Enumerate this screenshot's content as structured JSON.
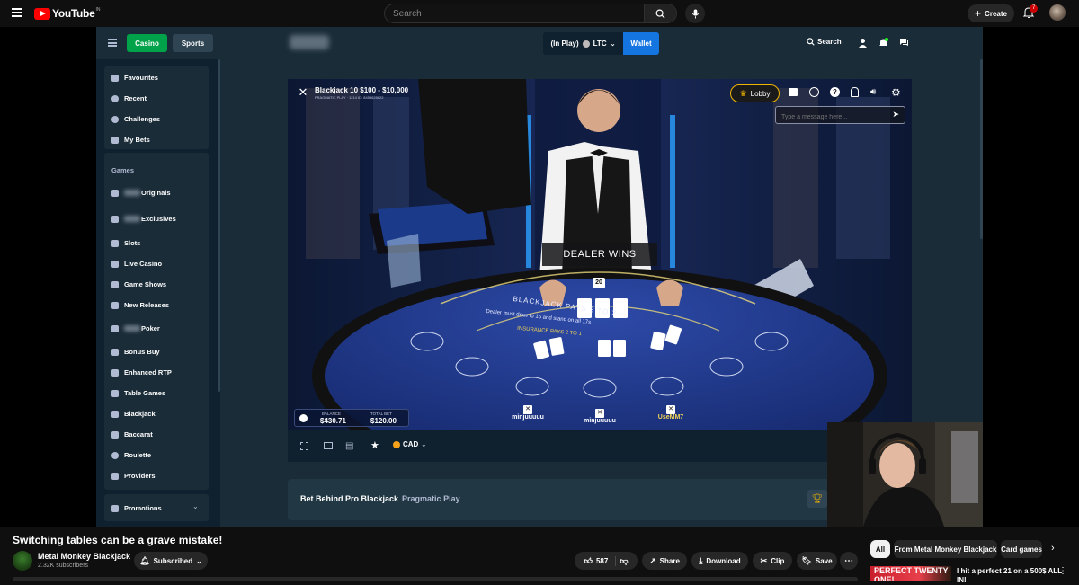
{
  "youtube": {
    "logo_text": "YouTube",
    "country_code": "IN",
    "search_placeholder": "Search",
    "create_label": "Create",
    "notification_count": "7"
  },
  "stake": {
    "tabs": {
      "casino": "Casino",
      "sports": "Sports"
    },
    "balance_label": "(In Play)",
    "currency": "LTC",
    "wallet_label": "Wallet",
    "search_label": "Search",
    "sidebar": {
      "top": [
        "Favourites",
        "Recent",
        "Challenges",
        "My Bets"
      ],
      "games_heading": "Games",
      "games": [
        {
          "label": "Originals",
          "icon": "flame-icon"
        },
        {
          "label": "Exclusives",
          "icon": "bookmark-icon"
        },
        {
          "label": "Slots",
          "icon": "slots-icon"
        },
        {
          "label": "Live Casino",
          "icon": "headset-icon"
        },
        {
          "label": "Game Shows",
          "icon": "gameshow-icon"
        },
        {
          "label": "New Releases",
          "icon": "new-icon"
        },
        {
          "label": "Poker",
          "icon": "poker-icon"
        },
        {
          "label": "Bonus Buy",
          "icon": "bonus-icon"
        },
        {
          "label": "Enhanced RTP",
          "icon": "rtp-icon"
        },
        {
          "label": "Table Games",
          "icon": "table-icon"
        },
        {
          "label": "Blackjack",
          "icon": "blackjack-icon"
        },
        {
          "label": "Baccarat",
          "icon": "baccarat-icon"
        },
        {
          "label": "Roulette",
          "icon": "roulette-icon"
        },
        {
          "label": "Providers",
          "icon": "providers-icon"
        }
      ],
      "promotions": "Promotions"
    },
    "game": {
      "table_title": "Blackjack 10 $100 - $10,000",
      "table_sub": "PRAGMATIC PLAY · 1214 ID: 8458625622",
      "lobby_label": "Lobby",
      "chat_placeholder": "Type a message here...",
      "result_banner": "DEALER WINS",
      "dealer_score": "20",
      "felt_line1": "BLACKJACK PAYS 3 TO 2",
      "felt_line2": "Dealer must draw to 16 and stand on all 17s",
      "felt_line3": "INSURANCE PAYS 2 TO 1",
      "balance_label": "BALANCE",
      "balance_value": "$430.71",
      "total_bet_label": "TOTAL BET",
      "total_bet_value": "$120.00",
      "bet_behind": "BET BEHIND",
      "players": [
        "minjuuuuu",
        "minjuuuuu",
        "UseMM7"
      ],
      "currency_label": "CAD"
    },
    "info": {
      "title": "Bet Behind Pro Blackjack",
      "provider": "Pragmatic Play"
    }
  },
  "video": {
    "title": "Switching tables can be a grave mistake!",
    "channel": "Metal Monkey Blackjack",
    "subscribers": "2.32K subscribers",
    "subscribed_label": "Subscribed",
    "likes": "587",
    "share_label": "Share",
    "download_label": "Download",
    "clip_label": "Clip",
    "save_label": "Save"
  },
  "chips": [
    "All",
    "From Metal Monkey Blackjack",
    "Card games"
  ],
  "recommendation": {
    "thumb_text": "PERFECT TWENTY ONE!",
    "title": "I hit a perfect 21 on a 500$ ALL IN!"
  }
}
